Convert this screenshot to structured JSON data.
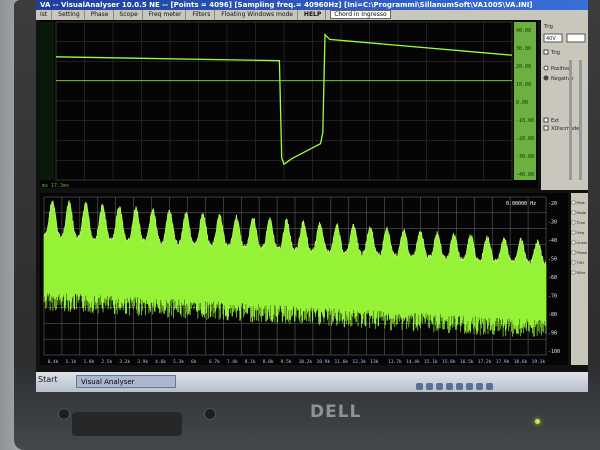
{
  "window": {
    "title": "VA -- VisualAnalyser 10.0.5 NE -- [Points = 4096] [Sampling freq.= 40960Hz] [Ini=C:\\Programmi\\SillanumSoft\\VA1005\\VA.INI]"
  },
  "menu": [
    "Ist",
    "Setting",
    "Phase",
    "Scope",
    "Freq meter",
    "Filters",
    "Floating Windows mode"
  ],
  "menu_help": "HELP",
  "menu_combo": "Chord in Ingresso",
  "scope": {
    "right_scale": [
      "40.00",
      "30.00",
      "20.00",
      "10.00",
      "0.00",
      "-10.00",
      "-20.00",
      "-30.00",
      "-40.00"
    ],
    "footer": "ms   17.3ms"
  },
  "right_panel": {
    "header": "Trig",
    "options": [
      "Trig",
      "Positive",
      "Negative",
      "Ext",
      "XDiscmode"
    ],
    "field": "40V"
  },
  "spectrum": {
    "readout": "0.00000 Hz",
    "left_scale": [
      "-20",
      "-30",
      "-40",
      "-50",
      "-60",
      "-70",
      "-80",
      "-90",
      "-100"
    ],
    "x_ticks": [
      "0.4k",
      "1.1k",
      "1.8k",
      "2.5k",
      "3.2k",
      "3.9k",
      "4.6k",
      "5.3k",
      "6k",
      "6.7k",
      "7.4k",
      "8.1k",
      "8.8k",
      "9.5k",
      "10.2k",
      "10.9k",
      "11.6k",
      "12.3k",
      "13k",
      "13.7k",
      "14.4k",
      "15.1k",
      "15.8k",
      "16.5k",
      "17.2k",
      "17.9k",
      "18.6k",
      "19.3k"
    ],
    "options": [
      "Peak",
      "Mode",
      "Time",
      "Freq",
      "Linear",
      "Phase",
      "THD",
      "Filter"
    ]
  },
  "taskbar": {
    "start": "Start",
    "app": "Visual Analyser"
  },
  "brand": "DELL",
  "colors": {
    "trace": "#9dff3a",
    "grid": "#3c3c3c",
    "accent_bar": "#7fd04a"
  }
}
